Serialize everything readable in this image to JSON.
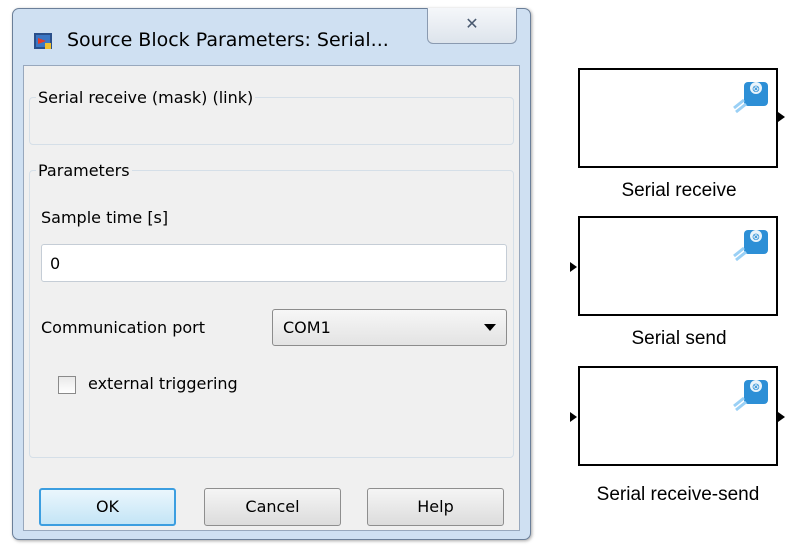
{
  "dialog": {
    "title": "Source Block Parameters: Serial...",
    "close_glyph": "✕",
    "description_group": "Serial receive (mask) (link)",
    "parameters_group": "Parameters",
    "sample_time_label": "Sample time [s]",
    "sample_time_value": "0",
    "comm_port_label": "Communication port",
    "comm_port_value": "COM1",
    "external_triggering_label": "external triggering",
    "external_triggering_checked": false,
    "ok_label": "OK",
    "cancel_label": "Cancel",
    "help_label": "Help"
  },
  "blocks": [
    {
      "name": "Serial receive",
      "inport": false,
      "outport": true
    },
    {
      "name": "Serial send",
      "inport": true,
      "outport": false
    },
    {
      "name": "Serial receive-send",
      "inport": true,
      "outport": true
    }
  ],
  "icons": {
    "title_icon": "simulink-block-icon",
    "block_icon": "serial-port-icon"
  }
}
